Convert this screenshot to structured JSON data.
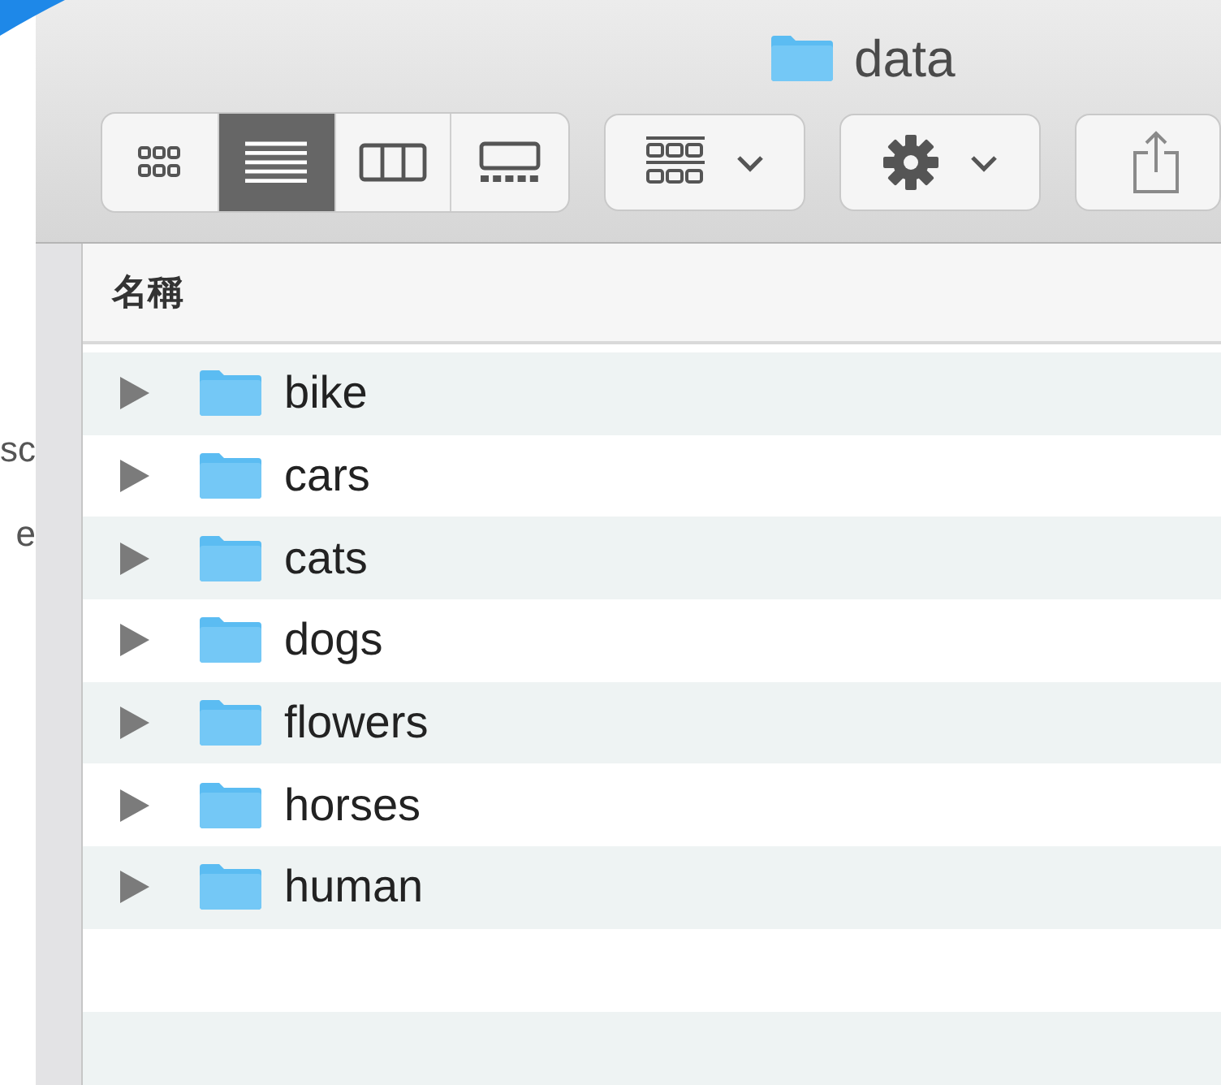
{
  "background_texts": [
    "sc",
    "e"
  ],
  "window": {
    "title": "data"
  },
  "view_buttons": [
    {
      "kind": "icon",
      "selected": false
    },
    {
      "kind": "list",
      "selected": true
    },
    {
      "kind": "column",
      "selected": false
    },
    {
      "kind": "gallery",
      "selected": false
    }
  ],
  "list": {
    "column_header": "名稱",
    "rows": [
      {
        "name": "bike",
        "expanded": false
      },
      {
        "name": "cars",
        "expanded": false
      },
      {
        "name": "cats",
        "expanded": false
      },
      {
        "name": "dogs",
        "expanded": false
      },
      {
        "name": "flowers",
        "expanded": false
      },
      {
        "name": "horses",
        "expanded": false
      },
      {
        "name": "human",
        "expanded": false
      }
    ]
  }
}
